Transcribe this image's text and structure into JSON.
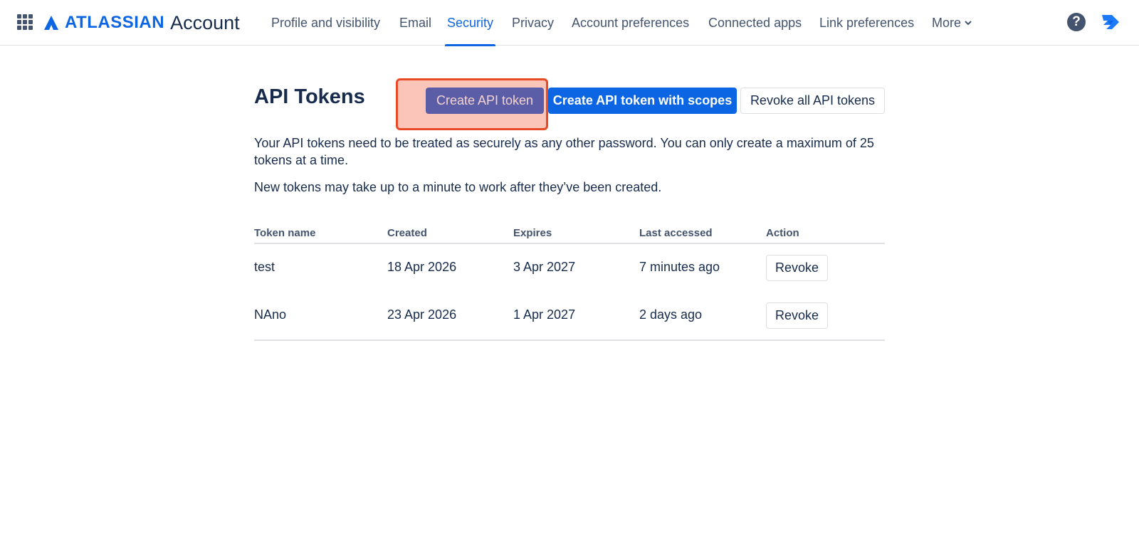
{
  "brand": {
    "name": "ATLASSIAN",
    "product": "Account",
    "accent_color": "#0c66e4"
  },
  "nav": {
    "items": [
      {
        "label": "Profile and visibility"
      },
      {
        "label": "Email"
      },
      {
        "label": "Security",
        "active": true
      },
      {
        "label": "Privacy"
      },
      {
        "label": "Account preferences"
      },
      {
        "label": "Connected apps"
      },
      {
        "label": "Link preferences"
      },
      {
        "label": "More"
      }
    ],
    "help_icon": "question-mark"
  },
  "main": {
    "title": "API Tokens",
    "buttons": {
      "create": "Create API token",
      "create_with_scopes": "Create API token with scopes",
      "revoke_all": "Revoke all API tokens"
    },
    "paragraph1": "Your API tokens need to be treated as securely as any other password. You can only create a maximum of 25 tokens at a time.",
    "paragraph2": "New tokens may take up to a minute to work after they’ve been created."
  },
  "table": {
    "headers": [
      "Token name",
      "Created",
      "Expires",
      "Last accessed",
      "Action"
    ],
    "rows": [
      {
        "name": "test",
        "created": "18 Apr 2026",
        "expires": "3 Apr 2027",
        "last_accessed": "7 minutes ago",
        "action": "Revoke"
      },
      {
        "name": "NAno",
        "created": "23 Apr 2026",
        "expires": "1 Apr 2027",
        "last_accessed": "2 days ago",
        "action": "Revoke"
      }
    ]
  },
  "highlight_color": "#e84a27"
}
